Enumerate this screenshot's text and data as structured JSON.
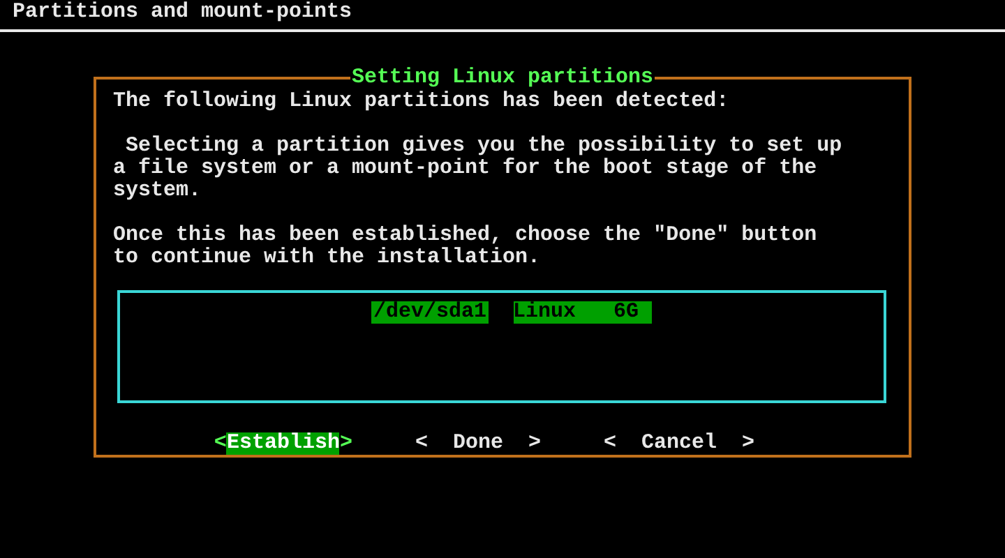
{
  "screen_title": "Partitions and mount-points",
  "dialog": {
    "title": "Setting Linux partitions",
    "paragraphs": [
      "The following Linux partitions has been detected:",
      " Selecting a partition gives you the possibility to set up\na file system or a mount-point for the boot stage of the\nsystem.",
      "Once this has been established, choose the \"Done\" button\nto continue with the installation."
    ],
    "partitions": [
      {
        "device": "/dev/sda1",
        "details": "Linux   6G",
        "selected": true
      }
    ],
    "buttons": [
      {
        "left": "<",
        "label": "Establish",
        "right": ">",
        "selected": true
      },
      {
        "left": "<",
        "label": "Done",
        "right": ">",
        "selected": false
      },
      {
        "left": "<",
        "label": "Cancel",
        "right": ">",
        "selected": false
      }
    ]
  }
}
